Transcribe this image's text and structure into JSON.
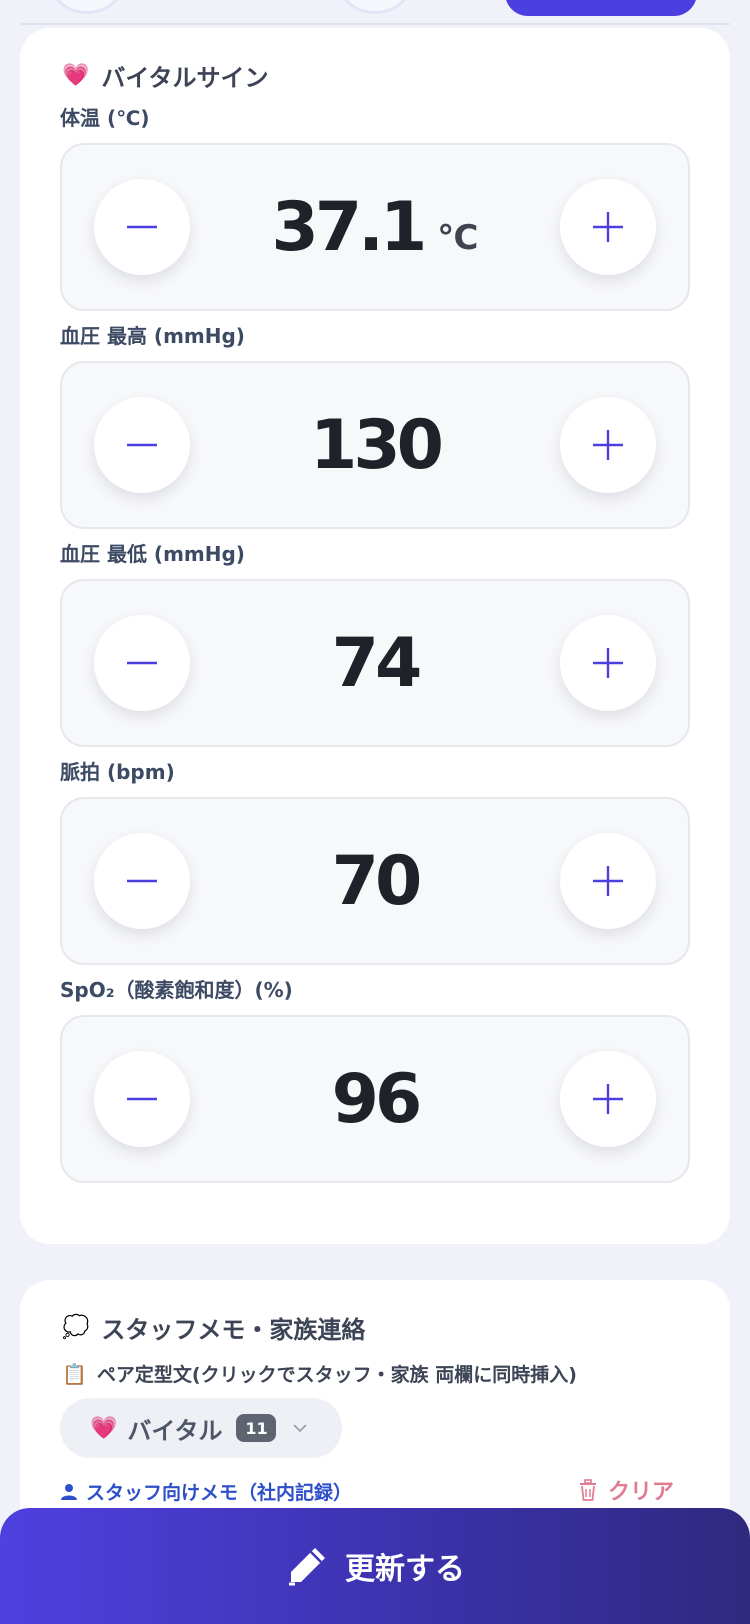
{
  "vitals_card": {
    "title": "バイタルサイン",
    "title_icon": "heart-icon",
    "items": [
      {
        "label": "体温 (℃)",
        "value": "37.1",
        "unit": "℃"
      },
      {
        "label": "血圧 最高 (mmHg)",
        "value": "130",
        "unit": ""
      },
      {
        "label": "血圧 最低 (mmHg)",
        "value": "74",
        "unit": ""
      },
      {
        "label": "脈拍 (bpm)",
        "value": "70",
        "unit": ""
      },
      {
        "label": "SpO₂（酸素飽和度）(%)",
        "value": "96",
        "unit": ""
      }
    ]
  },
  "memo_card": {
    "title": "スタッフメモ・家族連絡",
    "title_icon": "speech-bubble-icon",
    "template_hint": "ペア定型文(クリックでスタッフ・家族 両欄に同時挿入)",
    "template_hint_icon": "clipboard-icon",
    "category": {
      "label": "バイタル",
      "count": "11",
      "icon": "heart-icon"
    },
    "staff_memo_label": "スタッフ向けメモ（社内記録）",
    "clear_label": "クリア"
  },
  "update_button": {
    "label": "更新する",
    "icon": "pencil-icon"
  },
  "colors": {
    "accent": "#4c3fe0",
    "background": "#f1f2f9",
    "link": "#2d4fc9",
    "danger": "#e07b90",
    "value_text": "#20222a"
  }
}
